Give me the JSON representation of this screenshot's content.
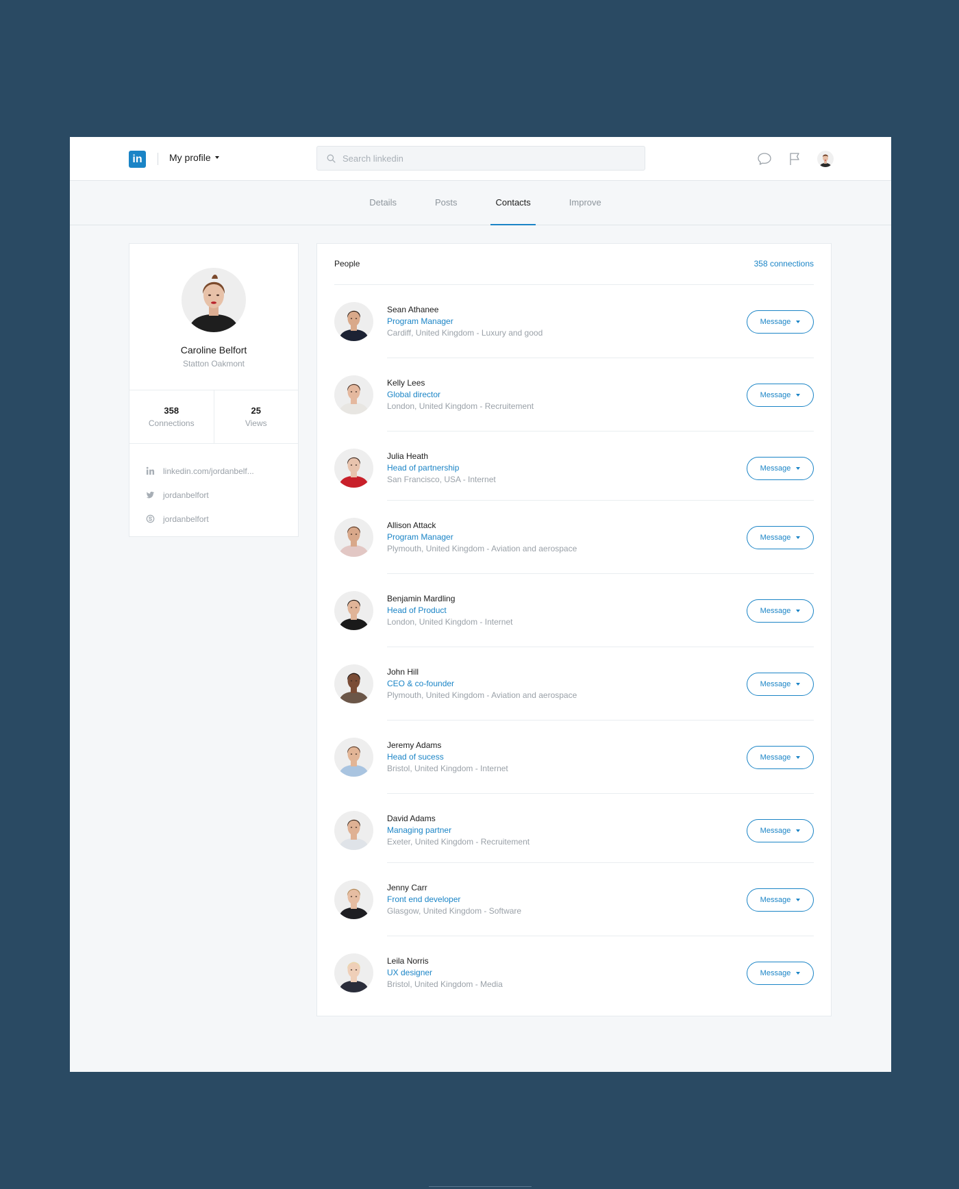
{
  "colors": {
    "background": "#2a4a63",
    "accent": "#1a84c6",
    "muted": "#9aa1a8"
  },
  "header": {
    "logo_text": "in",
    "profile_menu": "My profile",
    "search_placeholder": "Search linkedin",
    "icons": [
      "chat-icon",
      "flag-icon"
    ]
  },
  "tabs": [
    {
      "label": "Details"
    },
    {
      "label": "Posts"
    },
    {
      "label": "Contacts"
    },
    {
      "label": "Improve"
    }
  ],
  "profile": {
    "name": "Caroline Belfort",
    "company": "Statton Oakmont",
    "stats": [
      {
        "value": "358",
        "label": "Connections"
      },
      {
        "value": "25",
        "label": "Views"
      }
    ],
    "links": [
      {
        "icon": "linkedin-icon",
        "text": "linkedin.com/jordanbelf..."
      },
      {
        "icon": "twitter-icon",
        "text": "jordanbelfort"
      },
      {
        "icon": "skype-icon",
        "text": "jordanbelfort"
      }
    ]
  },
  "people": {
    "title": "People",
    "count": "358 connections",
    "button_label": "Message",
    "contacts": [
      {
        "name": "Sean Athanee",
        "title": "Program Manager",
        "meta": "Cardiff, United Kingdom - Luxury and good",
        "shirt": "#1c2233",
        "skin": "#d9a98a",
        "hair": "#2a1e18"
      },
      {
        "name": "Kelly Lees",
        "title": "Global director",
        "meta": "London, United Kingdom - Recruitement",
        "shirt": "#e8e6e2",
        "skin": "#e4b89e",
        "hair": "#4a3226"
      },
      {
        "name": "Julia Heath",
        "title": "Head of partnership",
        "meta": "San Francisco, USA - Internet",
        "shirt": "#c8202a",
        "skin": "#e8c3ad",
        "hair": "#3b2a22"
      },
      {
        "name": "Allison Attack",
        "title": "Program Manager",
        "meta": "Plymouth, United Kingdom - Aviation and aerospace",
        "shirt": "#e2c7c4",
        "skin": "#d8a88a",
        "hair": "#5a3a28"
      },
      {
        "name": "Benjamin Mardling",
        "title": "Head of Product",
        "meta": "London, United Kingdom - Internet",
        "shirt": "#1a1a1a",
        "skin": "#e0b498",
        "hair": "#1f1a17"
      },
      {
        "name": "John Hill",
        "title": "CEO & co-founder",
        "meta": "Plymouth, United Kingdom - Aviation and aerospace",
        "shirt": "#6b5648",
        "skin": "#7a4c36",
        "hair": "#1a1311"
      },
      {
        "name": "Jeremy Adams",
        "title": "Head of sucess",
        "meta": "Bristol, United Kingdom - Internet",
        "shirt": "#a9c4e0",
        "skin": "#e2b596",
        "hair": "#5b4030"
      },
      {
        "name": "David Adams",
        "title": "Managing partner",
        "meta": "Exeter, United Kingdom - Recruitement",
        "shirt": "#dfe3e8",
        "skin": "#dfb194",
        "hair": "#3c2c22"
      },
      {
        "name": "Jenny Carr",
        "title": "Front end developer",
        "meta": "Glasgow, United Kingdom - Software",
        "shirt": "#1e1e22",
        "skin": "#e6bda2",
        "hair": "#b08a5a"
      },
      {
        "name": "Leila Norris",
        "title": "UX designer",
        "meta": "Bristol, United Kingdom - Media",
        "shirt": "#2a2d3a",
        "skin": "#efcfb8",
        "hair": "#ead7a8"
      }
    ]
  }
}
